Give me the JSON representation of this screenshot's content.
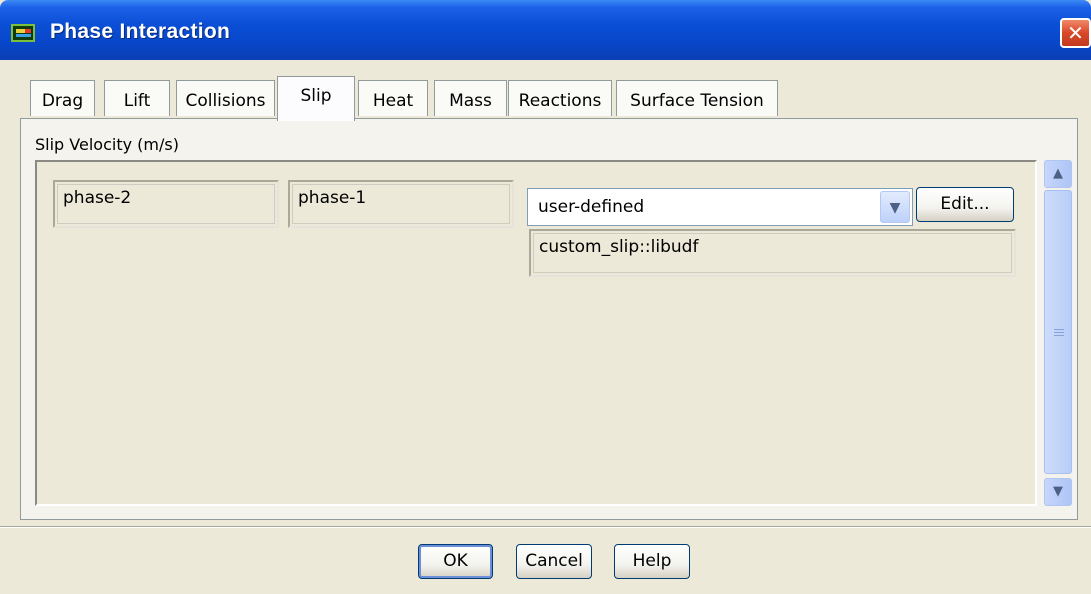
{
  "window": {
    "title": "Phase Interaction",
    "close_glyph": "✕"
  },
  "tabs": [
    {
      "label": "Drag",
      "active": false
    },
    {
      "label": "Lift",
      "active": false
    },
    {
      "label": "Collisions",
      "active": false
    },
    {
      "label": "Slip",
      "active": true
    },
    {
      "label": "Heat",
      "active": false
    },
    {
      "label": "Mass",
      "active": false
    },
    {
      "label": "Reactions",
      "active": false
    },
    {
      "label": "Surface Tension",
      "active": false
    }
  ],
  "slip": {
    "section_label": "Slip Velocity (m/s)",
    "phase_a": "phase-2",
    "phase_b": "phase-1",
    "method": "user-defined",
    "udf_name": "custom_slip::libudf",
    "edit_label": "Edit..."
  },
  "footer": {
    "ok_label": "OK",
    "cancel_label": "Cancel",
    "help_label": "Help"
  },
  "icons": {
    "app": "fluent-app-icon",
    "dropdown": "chevron-down-icon",
    "scroll_up": "chevron-up-icon",
    "scroll_down": "chevron-down-icon"
  },
  "colors": {
    "titlebar": "#0a4fd6",
    "close": "#d8482a",
    "face": "#ece9d8"
  }
}
